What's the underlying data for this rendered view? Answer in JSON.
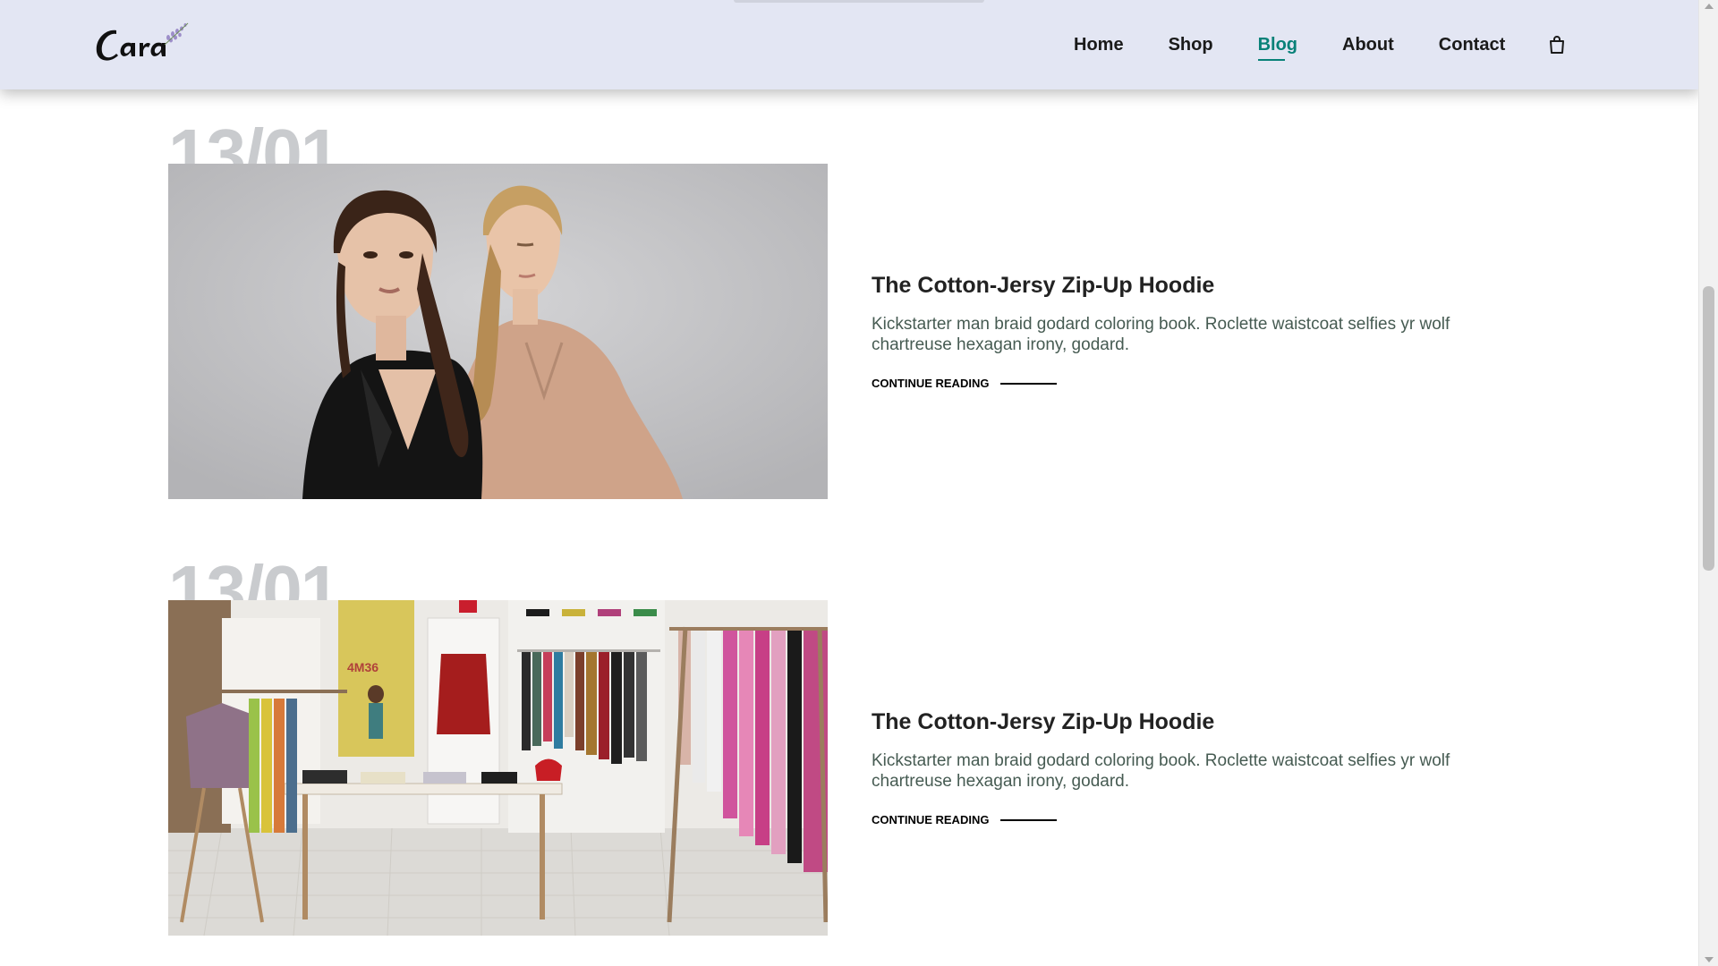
{
  "brand": {
    "logo_text": "Cara"
  },
  "nav": {
    "items": [
      {
        "label": "Home"
      },
      {
        "label": "Shop"
      },
      {
        "label": "Blog",
        "active": true
      },
      {
        "label": "About"
      },
      {
        "label": "Contact"
      }
    ],
    "cart_icon": "shopping-bag-icon",
    "active_color": "#088178"
  },
  "posts": [
    {
      "date": "13/01",
      "title": "The Cotton-Jersy Zip-Up Hoodie",
      "excerpt": "Kickstarter man braid godard coloring book. Roclette waistcoat selfies yr wolf chartreuse hexagan irony, godard.",
      "cta": "CONTINUE READING"
    },
    {
      "date": "13/01",
      "title": "The Cotton-Jersy Zip-Up Hoodie",
      "excerpt": "Kickstarter man braid godard coloring book. Roclette waistcoat selfies yr wolf chartreuse hexagan irony, godard.",
      "cta": "CONTINUE READING"
    }
  ],
  "store_sign_text": "4M36",
  "colors": {
    "header_bg": "#e3e6f3",
    "date_color": "#c9cbce",
    "excerpt_color": "#465b52"
  }
}
